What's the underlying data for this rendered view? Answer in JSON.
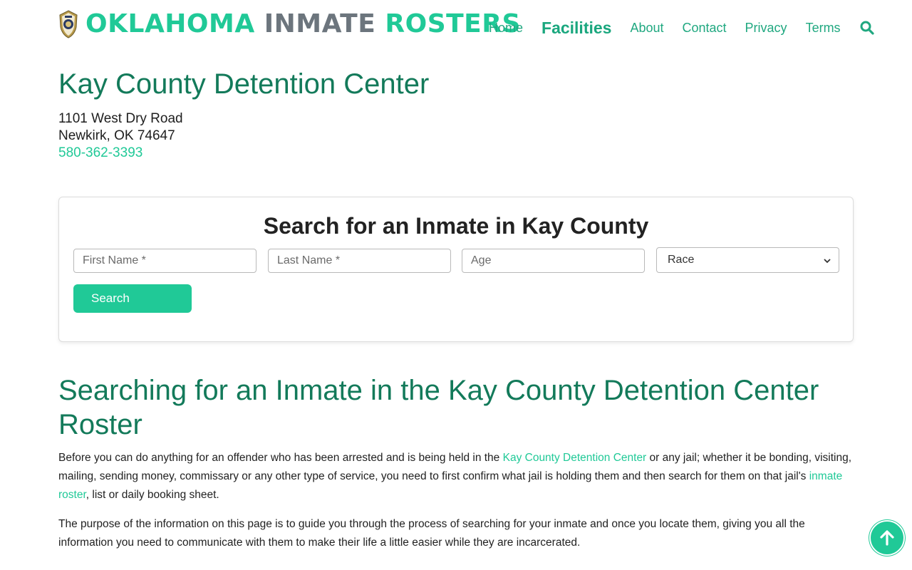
{
  "header": {
    "logo_words": [
      "OKLAHOMA",
      "INMATE",
      "ROSTERS"
    ],
    "nav": [
      "Home",
      "Facilities",
      "About",
      "Contact",
      "Privacy",
      "Terms"
    ],
    "active_nav": "Facilities",
    "search_icon": "search-icon"
  },
  "facility": {
    "name": "Kay County Detention Center",
    "address_line1": "1101 West Dry Road",
    "address_line2": "Newkirk, OK 74647",
    "phone": "580-362-3393"
  },
  "search_card": {
    "title": "Search for an Inmate in Kay County",
    "first_name_placeholder": "First Name *",
    "last_name_placeholder": "Last Name *",
    "age_placeholder": "Age",
    "race_selected": "Race",
    "button_label": "Search"
  },
  "article": {
    "title": "Searching for an Inmate in the Kay County Detention Center Roster",
    "p1_before_link1": "Before you can do anything for an offender who has been arrested and is being held in the ",
    "p1_link1": "Kay County Detention Center",
    "p1_middle": " or any jail; whether it be bonding, visiting, mailing, sending money, commissary or any other type of service, you need to first confirm what jail is holding them and then search for them on that jail's ",
    "p1_link2": "inmate roster",
    "p1_after": ", list or daily booking sheet.",
    "p2": "The purpose of the information on this page is to guide you through the process of searching for your inmate and once you locate them, giving you all the information you need to communicate with them to make their life a little easier while they are incarcerated."
  },
  "colors": {
    "accent": "#20c997",
    "heading": "#137a5a",
    "muted": "#6c757d"
  },
  "icons": {
    "logo": "sheriff-badge-icon",
    "back_to_top": "arrow-up-icon",
    "select_chevron": "chevron-down-icon"
  }
}
